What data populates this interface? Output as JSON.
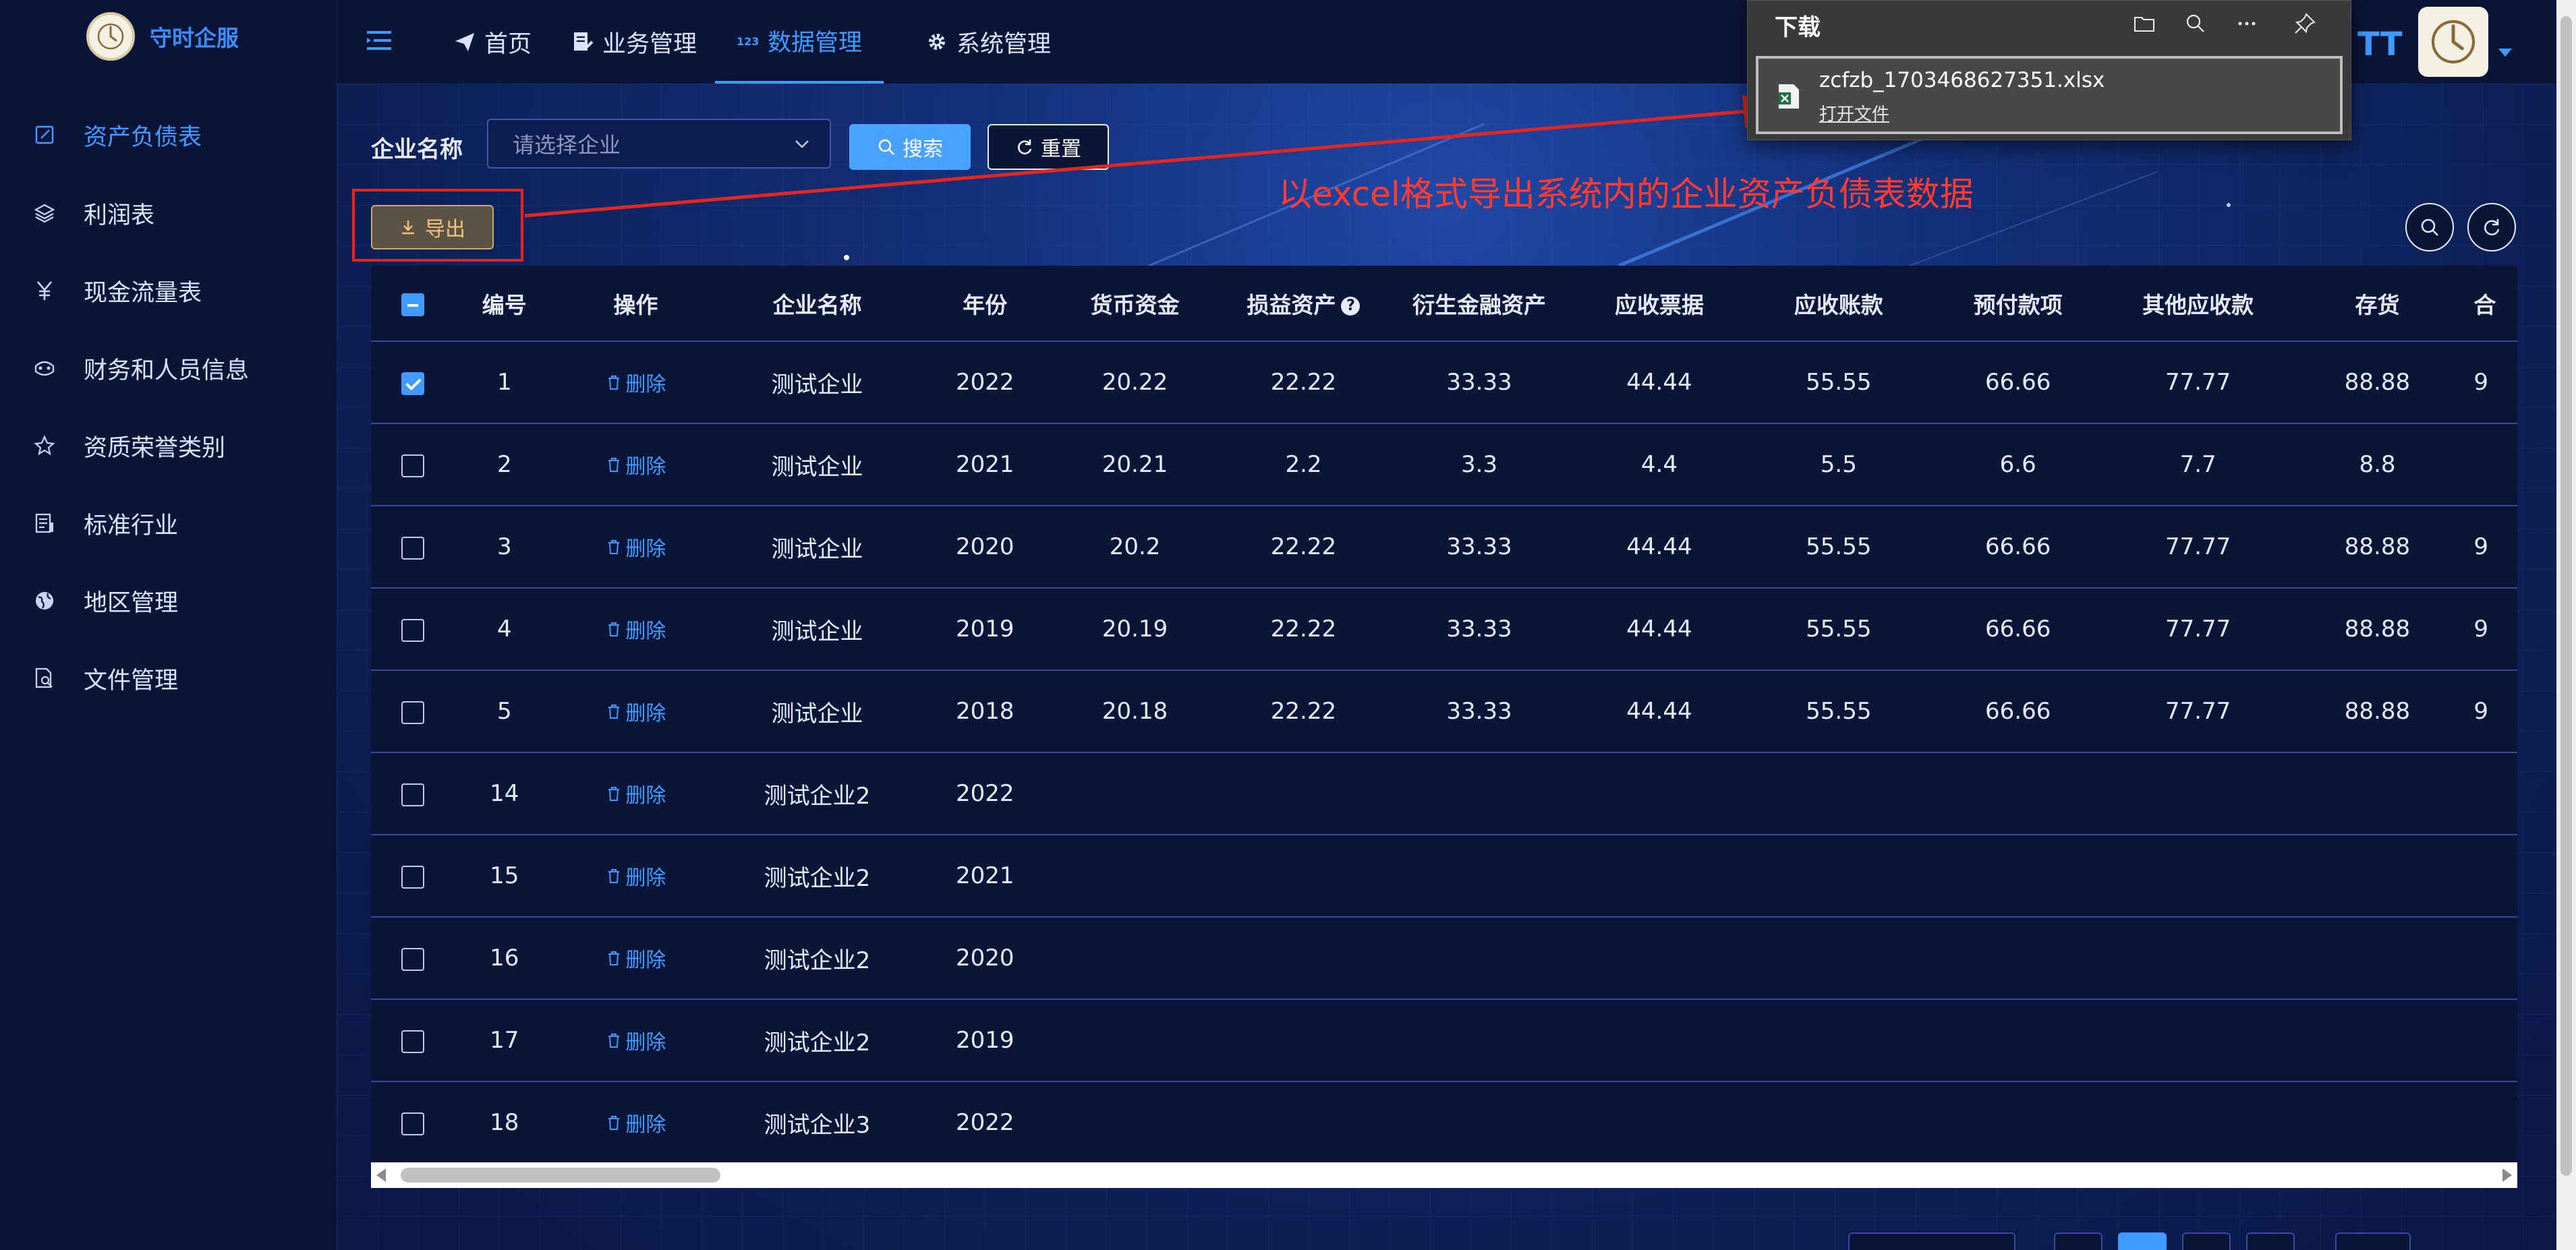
{
  "app": {
    "name": "守时企服"
  },
  "sidebar": {
    "items": [
      {
        "label": "资产负债表",
        "icon": "edit-icon",
        "active": true
      },
      {
        "label": "利润表",
        "icon": "layers-icon",
        "active": false
      },
      {
        "label": "现金流量表",
        "icon": "yen-icon",
        "active": false
      },
      {
        "label": "财务和人员信息",
        "icon": "mask-icon",
        "active": false
      },
      {
        "label": "资质荣誉类别",
        "icon": "star-icon",
        "active": false
      },
      {
        "label": "标准行业",
        "icon": "document-list-icon",
        "active": false
      },
      {
        "label": "地区管理",
        "icon": "globe-icon",
        "active": false
      },
      {
        "label": "文件管理",
        "icon": "file-search-icon",
        "active": false
      }
    ]
  },
  "topnav": {
    "tabs": [
      {
        "label": "首页",
        "icon": "send-icon",
        "active": false
      },
      {
        "label": "业务管理",
        "icon": "document-edit-icon",
        "active": false
      },
      {
        "label": "数据管理",
        "icon": "numbers-icon",
        "active": true
      },
      {
        "label": "系统管理",
        "icon": "gear-icon",
        "active": false
      }
    ],
    "font_size_icon": "TT"
  },
  "filter": {
    "label": "企业名称",
    "placeholder": "请选择企业",
    "search_label": "搜索",
    "reset_label": "重置"
  },
  "toolbar": {
    "export_label": "导出"
  },
  "annotation": {
    "text": "以excel格式导出系统内的企业资产负债表数据",
    "color": "#ff3b30"
  },
  "table": {
    "headers": [
      "编号",
      "操作",
      "企业名称",
      "年份",
      "货币资金",
      "损益资产",
      "衍生金融资产",
      "应收票据",
      "应收账款",
      "预付款项",
      "其他应收款",
      "存货",
      "合"
    ],
    "help_mark": "?",
    "delete_label": "删除",
    "rows": [
      {
        "checked": true,
        "id": "1",
        "company": "测试企业",
        "year": "2022",
        "cash": "20.22",
        "pl_assets": "22.22",
        "derivatives": "33.33",
        "notes_recv": "44.44",
        "accounts_recv": "55.55",
        "prepayments": "66.66",
        "other_recv": "77.77",
        "inventory": "88.88",
        "next": "9"
      },
      {
        "checked": false,
        "id": "2",
        "company": "测试企业",
        "year": "2021",
        "cash": "20.21",
        "pl_assets": "2.2",
        "derivatives": "3.3",
        "notes_recv": "4.4",
        "accounts_recv": "5.5",
        "prepayments": "6.6",
        "other_recv": "7.7",
        "inventory": "8.8",
        "next": ""
      },
      {
        "checked": false,
        "id": "3",
        "company": "测试企业",
        "year": "2020",
        "cash": "20.2",
        "pl_assets": "22.22",
        "derivatives": "33.33",
        "notes_recv": "44.44",
        "accounts_recv": "55.55",
        "prepayments": "66.66",
        "other_recv": "77.77",
        "inventory": "88.88",
        "next": "9"
      },
      {
        "checked": false,
        "id": "4",
        "company": "测试企业",
        "year": "2019",
        "cash": "20.19",
        "pl_assets": "22.22",
        "derivatives": "33.33",
        "notes_recv": "44.44",
        "accounts_recv": "55.55",
        "prepayments": "66.66",
        "other_recv": "77.77",
        "inventory": "88.88",
        "next": "9"
      },
      {
        "checked": false,
        "id": "5",
        "company": "测试企业",
        "year": "2018",
        "cash": "20.18",
        "pl_assets": "22.22",
        "derivatives": "33.33",
        "notes_recv": "44.44",
        "accounts_recv": "55.55",
        "prepayments": "66.66",
        "other_recv": "77.77",
        "inventory": "88.88",
        "next": "9"
      },
      {
        "checked": false,
        "id": "14",
        "company": "测试企业2",
        "year": "2022",
        "cash": "",
        "pl_assets": "",
        "derivatives": "",
        "notes_recv": "",
        "accounts_recv": "",
        "prepayments": "",
        "other_recv": "",
        "inventory": "",
        "next": ""
      },
      {
        "checked": false,
        "id": "15",
        "company": "测试企业2",
        "year": "2021",
        "cash": "",
        "pl_assets": "",
        "derivatives": "",
        "notes_recv": "",
        "accounts_recv": "",
        "prepayments": "",
        "other_recv": "",
        "inventory": "",
        "next": ""
      },
      {
        "checked": false,
        "id": "16",
        "company": "测试企业2",
        "year": "2020",
        "cash": "",
        "pl_assets": "",
        "derivatives": "",
        "notes_recv": "",
        "accounts_recv": "",
        "prepayments": "",
        "other_recv": "",
        "inventory": "",
        "next": ""
      },
      {
        "checked": false,
        "id": "17",
        "company": "测试企业2",
        "year": "2019",
        "cash": "",
        "pl_assets": "",
        "derivatives": "",
        "notes_recv": "",
        "accounts_recv": "",
        "prepayments": "",
        "other_recv": "",
        "inventory": "",
        "next": ""
      },
      {
        "checked": false,
        "id": "18",
        "company": "测试企业3",
        "year": "2022",
        "cash": "",
        "pl_assets": "",
        "derivatives": "",
        "notes_recv": "",
        "accounts_recv": "",
        "prepayments": "",
        "other_recv": "",
        "inventory": "",
        "next": ""
      }
    ]
  },
  "download_panel": {
    "title": "下载",
    "filename": "zcfzb_1703468627351.xlsx",
    "open_label": "打开文件"
  },
  "colors": {
    "accent": "#3f9bff",
    "background": "#0b1538",
    "highlight_red": "#e3261f",
    "export_text": "#f4c07b"
  }
}
